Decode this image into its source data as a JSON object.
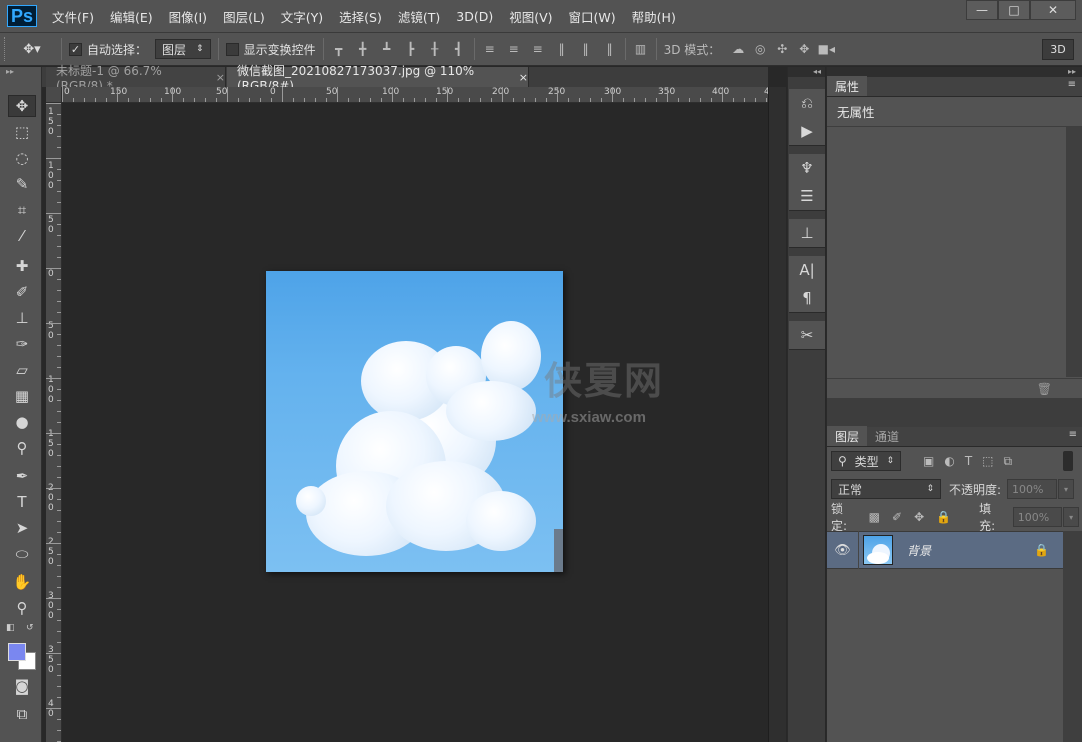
{
  "app": {
    "logo": "Ps",
    "menu": [
      "文件(F)",
      "编辑(E)",
      "图像(I)",
      "图层(L)",
      "文字(Y)",
      "选择(S)",
      "滤镜(T)",
      "3D(D)",
      "视图(V)",
      "窗口(W)",
      "帮助(H)"
    ],
    "window_controls": {
      "minimize": "—",
      "restore": "□",
      "close": "✕"
    }
  },
  "options_bar": {
    "auto_select_label": "自动选择：",
    "auto_select_checked": true,
    "auto_select_target": "图层",
    "show_transform_label": "显示变换控件",
    "show_transform_checked": false,
    "mode_3d_label": "3D 模式：",
    "btn_3d": "3D"
  },
  "tabs": [
    {
      "title": "未标题-1 @ 66.7%(RGB/8) *",
      "close": "×",
      "active": false
    },
    {
      "title": "微信截图_20210827173037.jpg @ 110%(RGB/8#)",
      "close": "×",
      "active": true
    }
  ],
  "ruler": {
    "horizontal": [
      "0",
      "150",
      "100",
      "50",
      "0",
      "50",
      "100",
      "150",
      "200",
      "250",
      "300",
      "350",
      "400",
      "4"
    ],
    "vertical": [
      "150",
      "100",
      "50",
      "0",
      "50",
      "100",
      "150",
      "200",
      "250",
      "300",
      "350",
      "40"
    ]
  },
  "watermark": {
    "main": "侠夏网",
    "sub": "www.sxiaw.com"
  },
  "properties_panel": {
    "tab": "属性",
    "content": "无属性"
  },
  "layers_panel": {
    "tabs": [
      "图层",
      "通道"
    ],
    "filter_type": "类型",
    "blend_mode": "正常",
    "opacity_label": "不透明度:",
    "opacity_value": "100%",
    "lock_label": "锁定:",
    "fill_label": "填充:",
    "fill_value": "100%",
    "layers": [
      {
        "name": "背景",
        "visible": true,
        "locked": true
      }
    ]
  },
  "colors": {
    "foreground": "#7a87f0",
    "background": "#ffffff"
  }
}
